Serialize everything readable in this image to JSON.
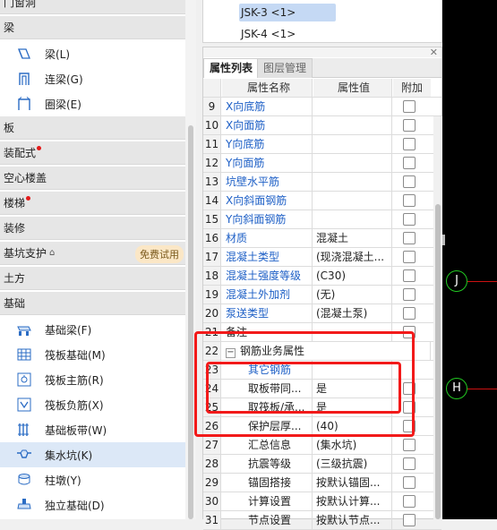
{
  "sidebar": {
    "items": [
      {
        "kind": "section",
        "label": "门窗洞",
        "dot": false
      },
      {
        "kind": "section",
        "label": "梁",
        "dot": false
      },
      {
        "kind": "item",
        "label": "梁(L)",
        "icon": "beam-icon"
      },
      {
        "kind": "item",
        "label": "连梁(G)",
        "icon": "coupling-beam-icon"
      },
      {
        "kind": "item",
        "label": "圈梁(E)",
        "icon": "ring-beam-icon"
      },
      {
        "kind": "section",
        "label": "板",
        "dot": false
      },
      {
        "kind": "section",
        "label": "装配式",
        "dot": true
      },
      {
        "kind": "section",
        "label": "空心楼盖",
        "dot": false
      },
      {
        "kind": "section",
        "label": "楼梯",
        "dot": true
      },
      {
        "kind": "section",
        "label": "装修",
        "dot": false
      },
      {
        "kind": "section-plain",
        "label": "基坑支护",
        "dot": false,
        "badge": "免费试用"
      },
      {
        "kind": "section",
        "label": "土方",
        "dot": false
      },
      {
        "kind": "section",
        "label": "基础",
        "dot": false
      },
      {
        "kind": "item",
        "label": "基础梁(F)",
        "icon": "foundation-beam-icon"
      },
      {
        "kind": "item",
        "label": "筏板基础(M)",
        "icon": "raft-foundation-icon"
      },
      {
        "kind": "item",
        "label": "筏板主筋(R)",
        "icon": "raft-main-rebar-icon"
      },
      {
        "kind": "item",
        "label": "筏板负筋(X)",
        "icon": "raft-negative-rebar-icon"
      },
      {
        "kind": "item",
        "label": "基础板带(W)",
        "icon": "foundation-strip-icon"
      },
      {
        "kind": "item",
        "label": "集水坑(K)",
        "icon": "sump-pit-icon",
        "selected": true
      },
      {
        "kind": "item",
        "label": "柱墩(Y)",
        "icon": "column-pier-icon"
      },
      {
        "kind": "item",
        "label": "独立基础(D)",
        "icon": "isolated-footing-icon"
      }
    ]
  },
  "component_list": {
    "items": [
      {
        "label": "JSK-3 <1>",
        "selected": true
      },
      {
        "label": "JSK-4 <1>",
        "selected": false
      }
    ]
  },
  "prop_panel": {
    "close_glyph": "✕",
    "tabs": [
      {
        "label": "属性列表",
        "active": true
      },
      {
        "label": "图层管理",
        "active": false
      }
    ],
    "columns": {
      "name": "属性名称",
      "value": "属性值",
      "add": "附加"
    },
    "rows": [
      {
        "num": "9",
        "name": "X向底筋",
        "value": "",
        "blue": true,
        "check": true
      },
      {
        "num": "10",
        "name": "X向面筋",
        "value": "",
        "blue": true,
        "check": true
      },
      {
        "num": "11",
        "name": "Y向底筋",
        "value": "",
        "blue": true,
        "check": true
      },
      {
        "num": "12",
        "name": "Y向面筋",
        "value": "",
        "blue": true,
        "check": true
      },
      {
        "num": "13",
        "name": "坑壁水平筋",
        "value": "",
        "blue": true,
        "check": true
      },
      {
        "num": "14",
        "name": "X向斜面钢筋",
        "value": "",
        "blue": true,
        "check": true
      },
      {
        "num": "15",
        "name": "Y向斜面钢筋",
        "value": "",
        "blue": true,
        "check": true
      },
      {
        "num": "16",
        "name": "材质",
        "value": "混凝土",
        "blue": true,
        "check": true
      },
      {
        "num": "17",
        "name": "混凝土类型",
        "value": "(现浇混凝土...",
        "blue": true,
        "check": true
      },
      {
        "num": "18",
        "name": "混凝土强度等级",
        "value": "(C30)",
        "blue": true,
        "check": true
      },
      {
        "num": "19",
        "name": "混凝土外加剂",
        "value": "(无)",
        "blue": true,
        "check": true
      },
      {
        "num": "20",
        "name": "泵送类型",
        "value": "(混凝土泵)",
        "blue": true,
        "check": true
      },
      {
        "num": "21",
        "name": "备注",
        "value": "",
        "blue": false,
        "check": true
      },
      {
        "num": "22",
        "name": "钢筋业务属性",
        "value": "",
        "blue": false,
        "check": false,
        "expander": "−",
        "group": true
      },
      {
        "num": "23",
        "name": "其它钢筋",
        "value": "",
        "blue": true,
        "check": false,
        "indent": true
      },
      {
        "num": "24",
        "name": "取板带同...",
        "value": "是",
        "blue": false,
        "check": true,
        "indent": true
      },
      {
        "num": "25",
        "name": "取筏板/承...",
        "value": "是",
        "blue": false,
        "check": true,
        "indent": true
      },
      {
        "num": "26",
        "name": "保护层厚...",
        "value": "(40)",
        "blue": false,
        "check": true,
        "indent": true
      },
      {
        "num": "27",
        "name": "汇总信息",
        "value": "(集水坑)",
        "blue": false,
        "check": true,
        "indent": true
      },
      {
        "num": "28",
        "name": "抗震等级",
        "value": "(三级抗震)",
        "blue": false,
        "check": true,
        "indent": true
      },
      {
        "num": "29",
        "name": "锚固搭接",
        "value": "按默认锚固...",
        "blue": false,
        "check": true,
        "indent": true
      },
      {
        "num": "30",
        "name": "计算设置",
        "value": "按默认计算...",
        "blue": false,
        "check": true,
        "indent": true
      },
      {
        "num": "31",
        "name": "节点设置",
        "value": "按默认节点...",
        "blue": false,
        "check": true,
        "indent": true
      }
    ]
  },
  "canvas": {
    "axis_labels": [
      "J",
      "H"
    ]
  },
  "colors": {
    "link_blue": "#1d5fc6",
    "highlight_red": "#f21a1a",
    "selection_blue": "#c5d9f4",
    "axis_green": "#22c822"
  }
}
